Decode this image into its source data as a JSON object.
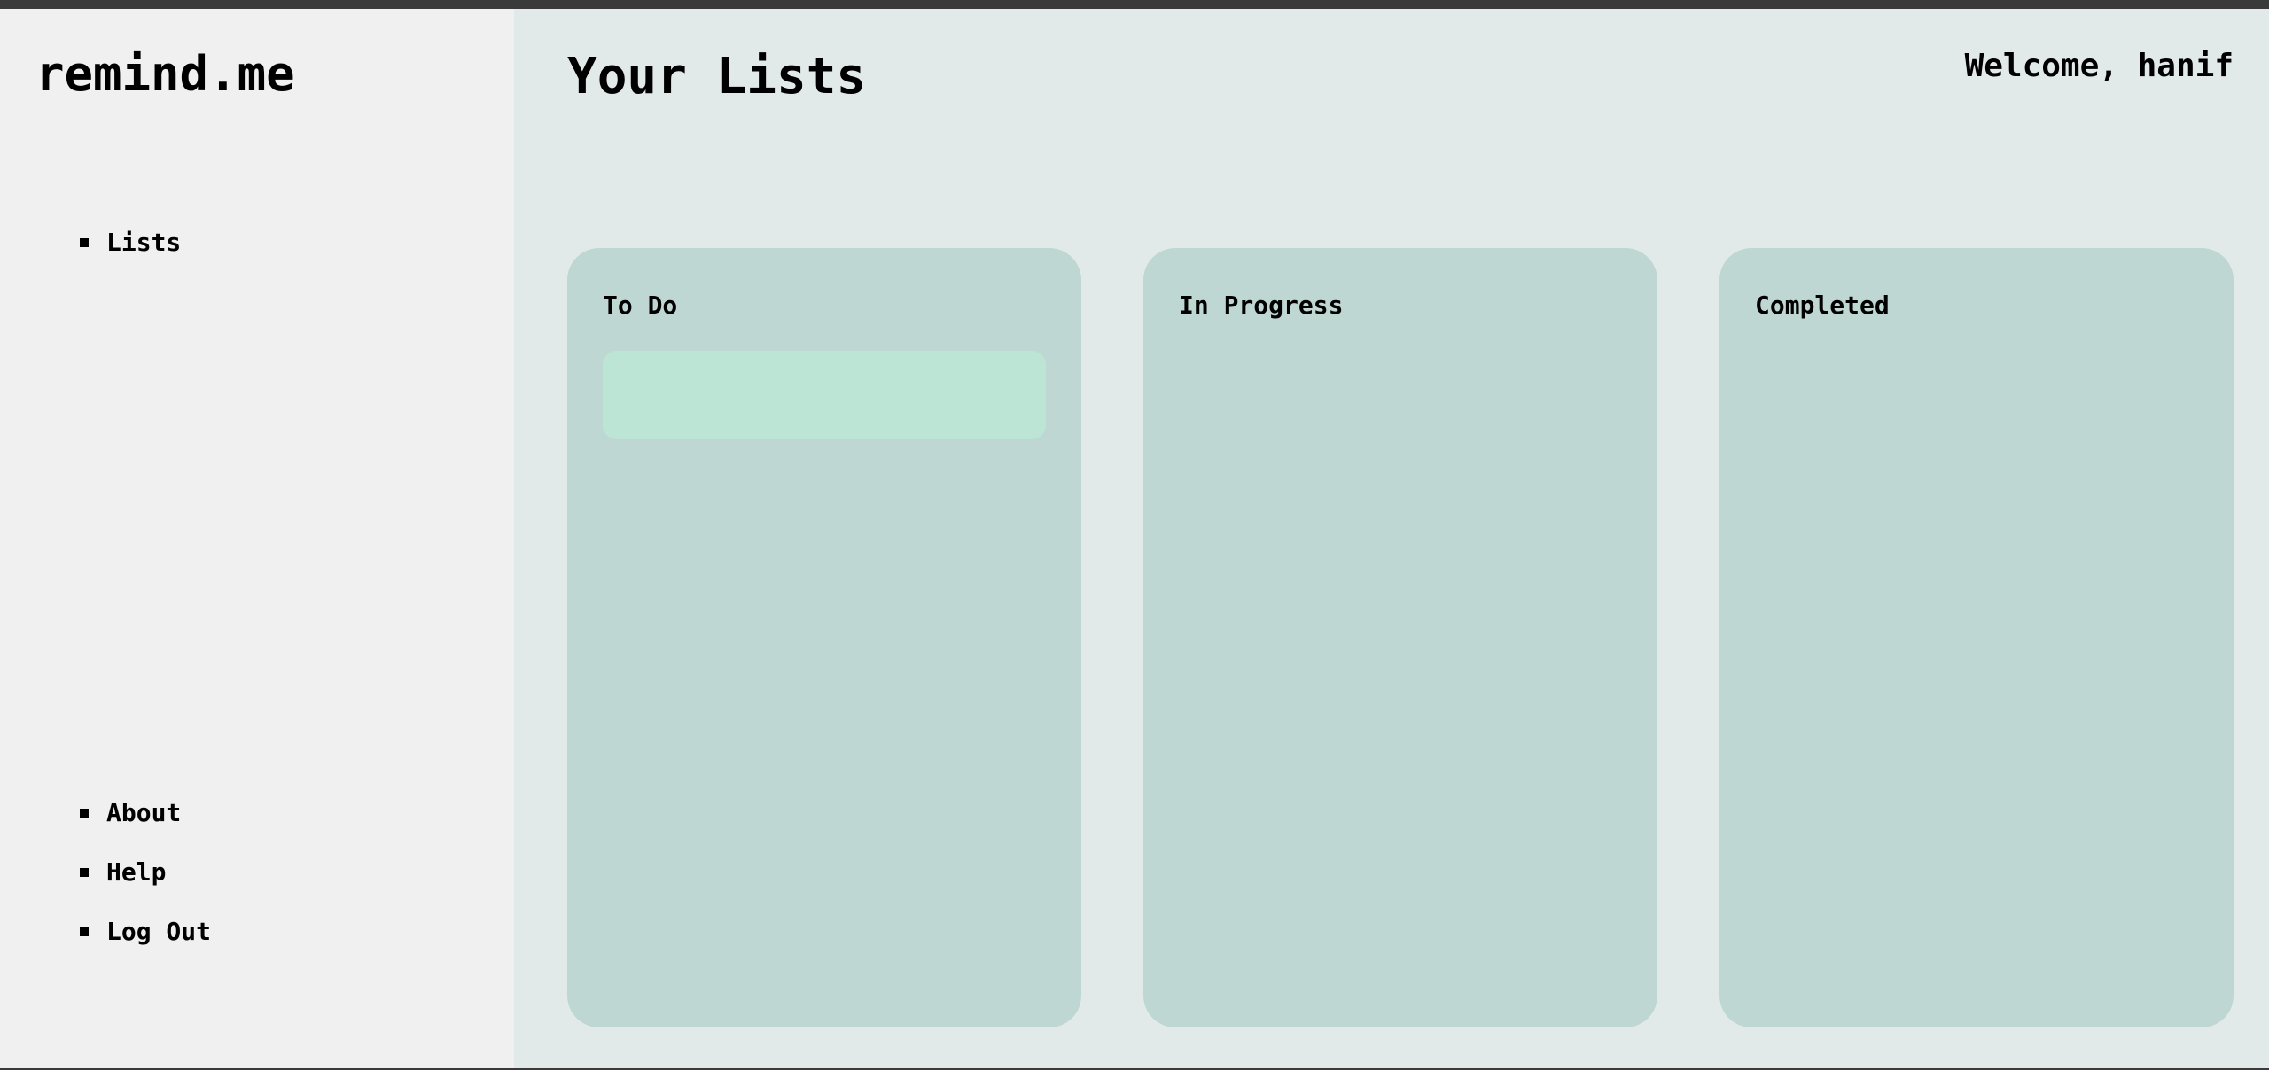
{
  "app": {
    "logo": "remind.me"
  },
  "sidebar": {
    "top_items": [
      {
        "label": "Lists"
      }
    ],
    "bottom_items": [
      {
        "label": "About"
      },
      {
        "label": "Help"
      },
      {
        "label": "Log Out"
      }
    ]
  },
  "header": {
    "title": "Your Lists",
    "welcome": "Welcome, hanif"
  },
  "lists": [
    {
      "title": "To Do",
      "cards": [
        ""
      ]
    },
    {
      "title": "In Progress",
      "cards": []
    },
    {
      "title": "Completed",
      "cards": []
    }
  ],
  "colors": {
    "sidebar_bg": "#f0f0f0",
    "main_bg": "#e2eae9",
    "column_bg": "#bfd7d3",
    "card_bg": "#bce5d5"
  }
}
